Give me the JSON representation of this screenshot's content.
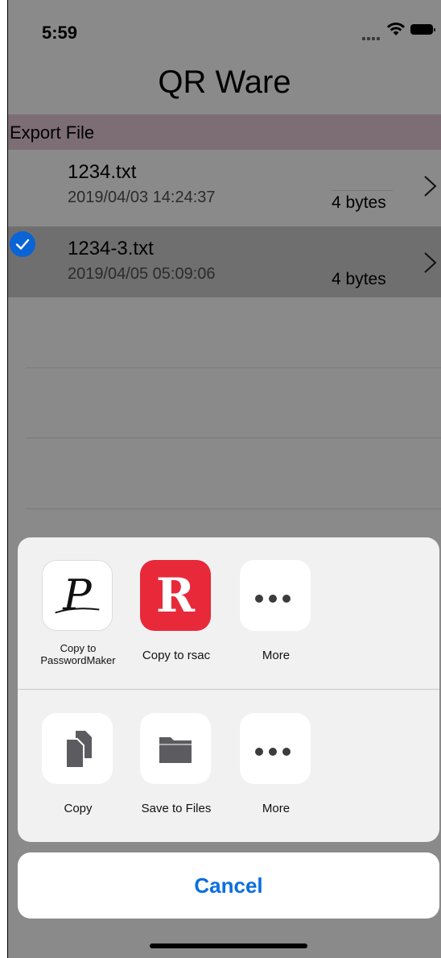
{
  "status_bar": {
    "time": "5:59"
  },
  "app": {
    "title": "QR Ware"
  },
  "section": {
    "header": "Export File"
  },
  "files": [
    {
      "name": "1234.txt",
      "date": "2019/04/03  14:24:37",
      "size": "4 bytes",
      "selected": false
    },
    {
      "name": "1234-3.txt",
      "date": "2019/04/05  05:09:06",
      "size": "4 bytes",
      "selected": true
    }
  ],
  "share_sheet": {
    "apps": [
      {
        "label": "Copy to\nPasswordMaker",
        "icon": "passwordmaker-app-icon"
      },
      {
        "label": "Copy to rsac",
        "icon": "rsac-app-icon",
        "icon_letter": "R"
      },
      {
        "label": "More",
        "icon": "more-icon"
      }
    ],
    "actions": [
      {
        "label": "Copy",
        "icon": "copy-icon"
      },
      {
        "label": "Save to Files",
        "icon": "folder-icon"
      },
      {
        "label": "More",
        "icon": "more-icon"
      }
    ],
    "cancel_label": "Cancel"
  },
  "colors": {
    "accent": "#0a6ee0",
    "rsac_red": "#e8293a",
    "selected_check": "#0a64d6"
  }
}
